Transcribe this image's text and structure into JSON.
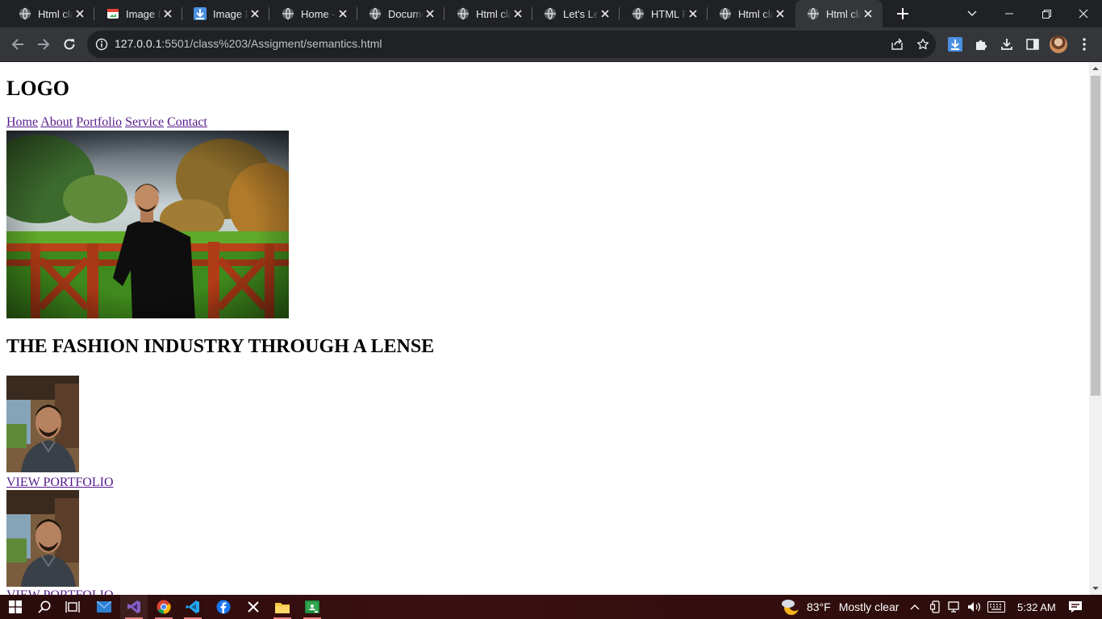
{
  "browser": {
    "tabs": [
      {
        "title": "Html class",
        "favicon": "globe-icon"
      },
      {
        "title": "Image Downloader",
        "favicon": "image-downloader-icon"
      },
      {
        "title": "Image Downloader",
        "favicon": "download-arrow-icon"
      },
      {
        "title": "Home - ",
        "favicon": "globe-icon"
      },
      {
        "title": "Document",
        "favicon": "globe-icon"
      },
      {
        "title": "Html class",
        "favicon": "globe-icon"
      },
      {
        "title": "Let's Learn",
        "favicon": "globe-icon"
      },
      {
        "title": "HTML Form",
        "favicon": "globe-icon"
      },
      {
        "title": "Html class",
        "favicon": "globe-icon"
      },
      {
        "title": "Html class",
        "favicon": "globe-icon",
        "active": true
      }
    ],
    "address": {
      "host": "127.0.0.1",
      "path": ":5501/class%203/Assigment/semantics.html"
    }
  },
  "page": {
    "logo": "LOGO",
    "nav": [
      "Home",
      "About",
      "Portfolio",
      "Service",
      "Contact"
    ],
    "heading": "THE FASHION INDUSTRY THROUGH A LENSE",
    "portfolio_link": "VIEW PORTFOLIO",
    "link_color": "#551a8b"
  },
  "taskbar": {
    "weather": {
      "temp": "83°F",
      "condition": "Mostly clear"
    },
    "time": "5:32 AM"
  }
}
